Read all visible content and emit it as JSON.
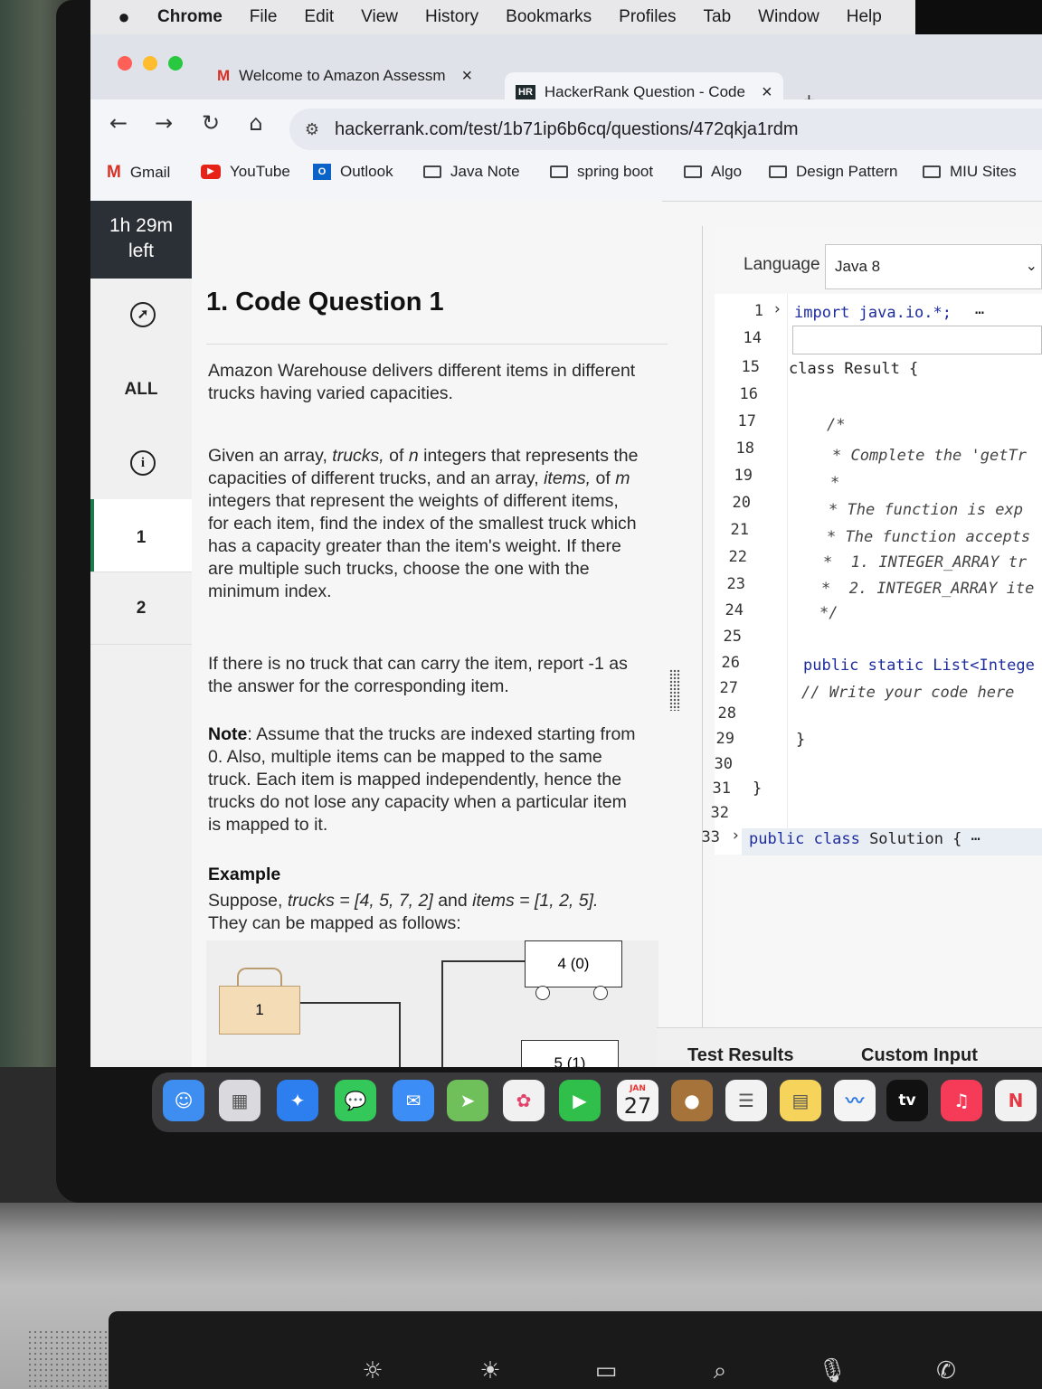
{
  "menubar": {
    "apple": "",
    "items": [
      "Chrome",
      "File",
      "Edit",
      "View",
      "History",
      "Bookmarks",
      "Profiles",
      "Tab",
      "Window",
      "Help"
    ]
  },
  "tabs": [
    {
      "favicon": "M",
      "title": "Welcome to Amazon Assessm",
      "close": "×"
    },
    {
      "favicon": "HR",
      "title": "HackerRank Question - Code",
      "close": "×"
    }
  ],
  "new_tab": "+",
  "address_bar": {
    "url": "hackerrank.com/test/1b71ip6b6cq/questions/472qkja1rdm"
  },
  "bookmarks": [
    "Gmail",
    "YouTube",
    "Outlook",
    "Java Note",
    "spring boot",
    "Algo",
    "Design Pattern",
    "MIU Sites"
  ],
  "sidebar": {
    "timer_value": "1h 29m",
    "timer_unit": "left",
    "all_label": "ALL",
    "info_glyph": "i",
    "q1": "1",
    "q2": "2"
  },
  "question": {
    "title": "1. Code Question 1",
    "p1": "Amazon Warehouse delivers different items in different trucks having varied capacities.",
    "p2_a": "Given an array, ",
    "p2_trucks": "trucks,",
    "p2_b": " of ",
    "p2_n": "n",
    "p2_c": " integers that represents the capacities of different trucks, and an array, ",
    "p2_items": "items,",
    "p2_d": " of ",
    "p2_m": "m",
    "p2_e": " integers that represent the weights of different items, for each item, find the index of the smallest truck which has a capacity greater than the item's weight. If there are multiple such trucks, choose the one with the minimum index.",
    "p3": "If there is no truck that can carry the item, report -1 as the answer for the corresponding item.",
    "note_label": "Note",
    "note_text": ": Assume that the trucks are indexed starting from 0. Also, multiple items can be mapped to the same truck. Each item is mapped independently, hence the trucks do not lose any capacity when a particular item is mapped to it.",
    "example_heading": "Example",
    "ex_a": "Suppose, ",
    "ex_trucks": "trucks = [4, 5, 7, 2]",
    "ex_b": " and ",
    "ex_items": "items = [1, 2, 5].",
    "ex_c": "They can be mapped as follows:",
    "diagram": {
      "item_label": "1",
      "truck1": "4 (0)",
      "truck2": "5 (1)"
    }
  },
  "editor": {
    "language_label": "Language",
    "language_value": "Java 8",
    "line_numbers": [
      "1",
      "14",
      "15",
      "16",
      "17",
      "18",
      "19",
      "20",
      "21",
      "22",
      "23",
      "24",
      "25",
      "26",
      "27",
      "28",
      "29",
      "30",
      "31",
      "32",
      "33"
    ],
    "lines": {
      "l1": "import java.io.*;",
      "l1_more": "⋯",
      "l15": "class Result {",
      "l17": "/*",
      "l18": "* Complete the 'getTr",
      "l19": "*",
      "l20": "* The function is exp",
      "l21": "* The function accepts",
      "l22": "*  1. INTEGER_ARRAY tr",
      "l23": "*  2. INTEGER_ARRAY ite",
      "l24": "*/",
      "l26": "public static List<Intege",
      "l27": "// Write your code here",
      "l29": "}",
      "l31": "}",
      "l33_kw": "public class",
      "l33_rest": " Solution {",
      "l33_more": "⋯"
    }
  },
  "result_tabs": [
    "Test Results",
    "Custom Input"
  ],
  "dock": {
    "calendar_month": "JAN",
    "calendar_day": "27",
    "tv_label": "tv"
  },
  "colors": {
    "timer_bg": "#2b3036",
    "keyword": "#1d2c9e",
    "traffic_red": "#fe5f57",
    "traffic_yellow": "#febc2e",
    "traffic_green": "#28c840"
  }
}
